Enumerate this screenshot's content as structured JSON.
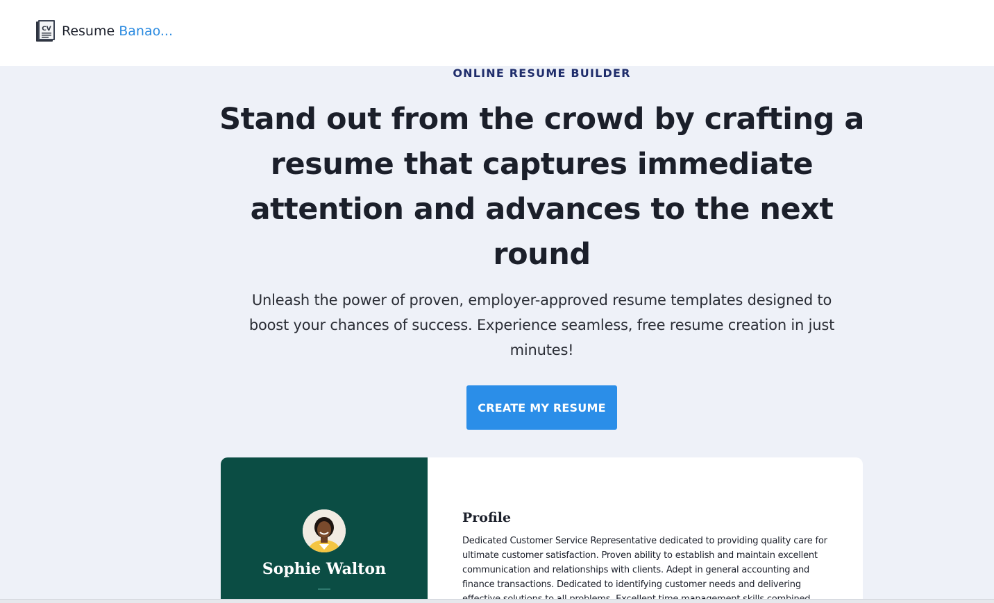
{
  "header": {
    "brand_word": "Resume",
    "brand_accent": "Banao...",
    "logo_icon": "cv-document-icon"
  },
  "hero": {
    "eyebrow": "ONLINE RESUME BUILDER",
    "headline_lines": [
      "Stand out from the crowd by crafting a",
      "resume that captures immediate",
      "attention and advances to the next",
      "round"
    ],
    "subtext_lines": [
      "Unleash the power of proven, employer-approved resume templates designed to",
      "boost your chances of success. Experience seamless, free resume creation in just",
      "minutes!"
    ],
    "cta_label": "CREATE MY RESUME"
  },
  "preview": {
    "name": "Sophie Walton",
    "avatar_icon": "profile-photo",
    "profile_heading": "Profile",
    "profile_lines": [
      "Dedicated Customer Service Representative dedicated to providing quality care for",
      "ultimate customer satisfaction. Proven ability to establish and maintain excellent",
      "communication and relationships with clients. Adept in general accounting and",
      "finance transactions. Dedicated to identifying customer needs and delivering",
      "effective solutions to all problems. Excellent time management skills combined with"
    ]
  },
  "colors": {
    "accent": "#2b8ee8",
    "brand_accent": "#2a8ae0",
    "sidebar_green": "#0b4d44",
    "hero_bg": "#eef1f8",
    "text_dark": "#1b1f2a",
    "eyebrow": "#1f2d6b"
  }
}
